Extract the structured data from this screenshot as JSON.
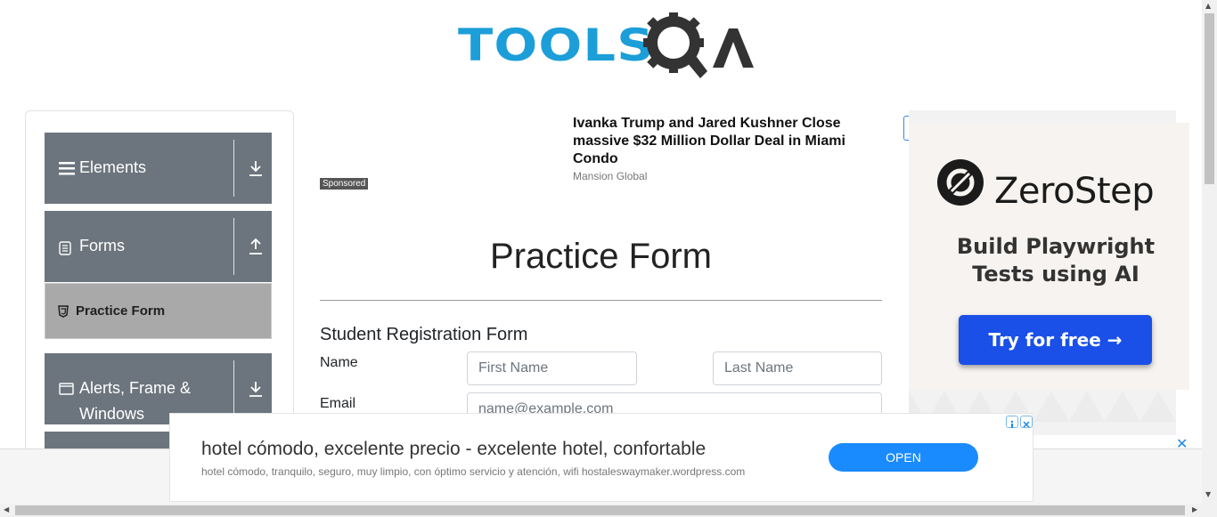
{
  "logo": {
    "text": "TOOLS",
    "suffix": "A"
  },
  "sidebar": {
    "groups": [
      {
        "label": "Elements",
        "icon": "hamburger-icon",
        "arrow": "download-arrow-icon"
      },
      {
        "label": "Forms",
        "icon": "document-icon",
        "arrow": "upload-arrow-icon"
      },
      {
        "label": "Alerts, Frame &",
        "label2": "Windows",
        "icon": "window-icon",
        "arrow": "download-arrow-icon"
      }
    ],
    "active_item": {
      "label": "Practice Form",
      "icon": "html5-icon"
    }
  },
  "sponsored": {
    "badge": "Sponsored",
    "headline": "Ivanka Trump and Jared Kushner Close massive $32 Million Dollar Deal in Miami Condo",
    "source": "Mansion Global"
  },
  "form": {
    "title": "Practice Form",
    "subtitle": "Student Registration Form",
    "name_label": "Name",
    "first_name_placeholder": "First Name",
    "last_name_placeholder": "Last Name",
    "email_label": "Email",
    "email_placeholder": "name@example.com"
  },
  "right_ad": {
    "brand": "ZeroStep",
    "tagline": "Build Playwright Tests using AI",
    "cta": "Try for free →"
  },
  "bottom_ad": {
    "title": "hotel cómodo, excelente precio - excelente hotel, confortable",
    "description": "hotel cómodo, tranquilo, seguro, muy limpio, con óptimo servicio y atención, wifi hostaleswaymaker.wordpress.com",
    "cta": "OPEN",
    "close": "✕"
  },
  "colors": {
    "brand_blue": "#1c9ed8",
    "logo_dark": "#333333",
    "sidebar_gray": "#6c757d",
    "active_gray": "#a9a9a9",
    "ad_button": "#1a4fe8",
    "open_button": "#1a8bff"
  }
}
